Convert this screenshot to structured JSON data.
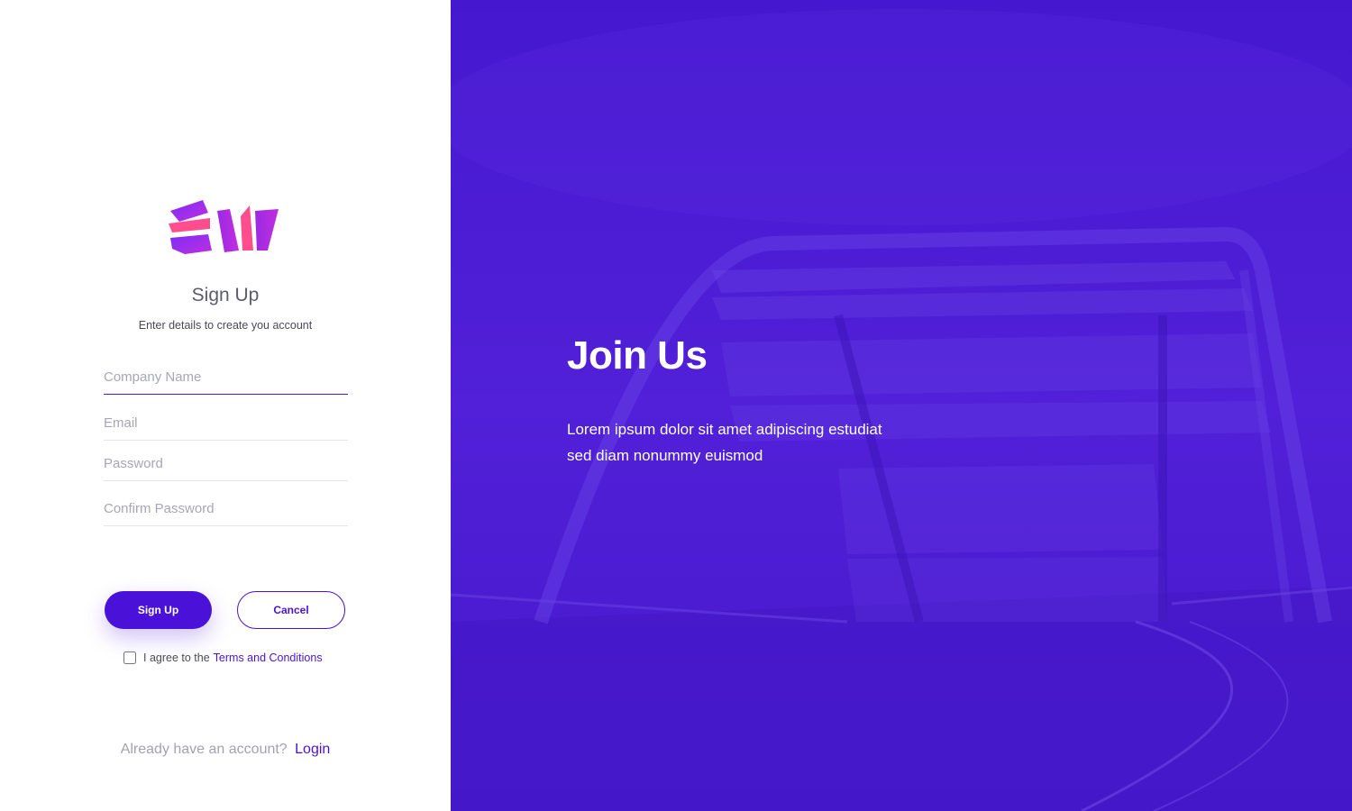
{
  "logo": {
    "name": "logo-icon",
    "colors": [
      "#8a2be2",
      "#ff4d8d",
      "#c22ce0"
    ]
  },
  "signup": {
    "title": "Sign Up",
    "subtitle": "Enter details to create you account",
    "fields": {
      "company": {
        "placeholder": "Company Name",
        "value": ""
      },
      "email": {
        "placeholder": "Email",
        "value": ""
      },
      "password": {
        "placeholder": "Password",
        "value": ""
      },
      "confirm": {
        "placeholder": "Confirm Password",
        "value": ""
      }
    },
    "buttons": {
      "signup": "Sign Up",
      "cancel": "Cancel"
    },
    "terms": {
      "prefix": "I agree to the",
      "link": "Terms and Conditions",
      "checked": false
    },
    "already": {
      "text": "Already have an account?",
      "link": "Login"
    }
  },
  "hero": {
    "title": "Join Us",
    "description_line1": "Lorem ipsum dolor sit amet adipiscing estudiat",
    "description_line2": "sed diam nonummy euismod",
    "background_color": "#4a1bd1",
    "image": "bridge-photo"
  },
  "colors": {
    "accent": "#4a12d9",
    "muted": "#a7a7b4"
  }
}
